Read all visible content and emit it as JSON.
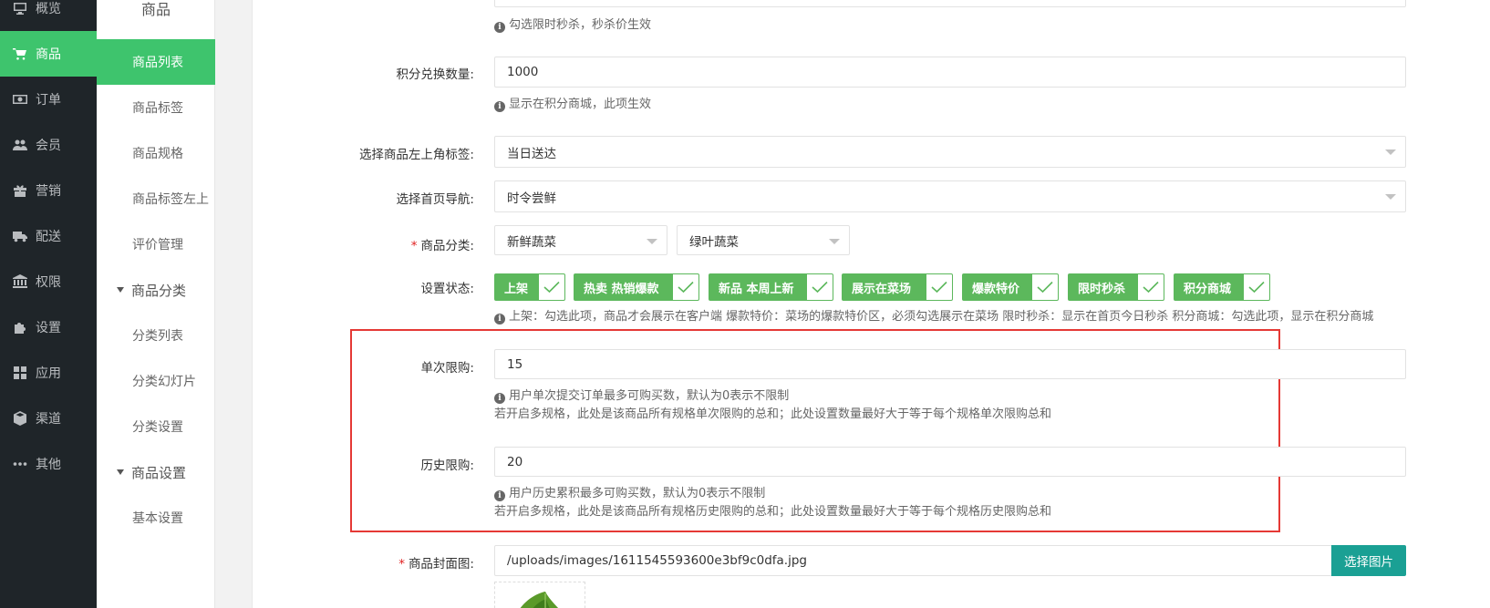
{
  "sidebar": {
    "items": [
      {
        "label": "概览",
        "icon": "monitor-icon"
      },
      {
        "label": "商品",
        "icon": "cart-icon"
      },
      {
        "label": "订单",
        "icon": "money-icon"
      },
      {
        "label": "会员",
        "icon": "users-icon"
      },
      {
        "label": "营销",
        "icon": "gift-icon"
      },
      {
        "label": "配送",
        "icon": "truck-icon"
      },
      {
        "label": "权限",
        "icon": "bank-icon"
      },
      {
        "label": "设置",
        "icon": "puzzle-icon"
      },
      {
        "label": "应用",
        "icon": "apps-icon"
      },
      {
        "label": "渠道",
        "icon": "cube-icon"
      },
      {
        "label": "其他",
        "icon": "dots-icon"
      }
    ]
  },
  "submenu": {
    "title": "商品",
    "items": {
      "list": "商品列表",
      "tags": "商品标签",
      "specs": "商品规格",
      "tag_topleft": "商品标签左上",
      "reviews": "评价管理",
      "group_category": "商品分类",
      "category_list": "分类列表",
      "category_slides": "分类幻灯片",
      "category_settings": "分类设置",
      "group_settings": "商品设置",
      "basic_settings": "基本设置"
    }
  },
  "form": {
    "flash_help": "勾选限时秒杀，秒杀价生效",
    "points": {
      "label": "积分兑换数量:",
      "value": "1000",
      "help": "显示在积分商城，此项生效"
    },
    "corner_tag": {
      "label": "选择商品左上角标签:",
      "value": "当日送达"
    },
    "home_nav": {
      "label": "选择首页导航:",
      "value": "时令尝鲜"
    },
    "category": {
      "required": "*",
      "label": "商品分类:",
      "first": "新鲜蔬菜",
      "second": "绿叶蔬菜"
    },
    "status": {
      "label": "设置状态:",
      "tags": [
        "上架",
        "热卖 热销爆款",
        "新品 本周上新",
        "展示在菜场",
        "爆款特价",
        "限时秒杀",
        "积分商城"
      ],
      "help": "上架：勾选此项，商品才会展示在客户端      爆款特价：菜场的爆款特价区，必须勾选展示在菜场      限时秒杀：显示在首页今日秒杀      积分商城：勾选此项，显示在积分商城"
    },
    "single_limit": {
      "label": "单次限购:",
      "value": "15",
      "help1": "用户单次提交订单最多可购买数，默认为0表示不限制",
      "help2": "若开启多规格，此处是该商品所有规格单次限购的总和；此处设置数量最好大于等于每个规格单次限购总和"
    },
    "history_limit": {
      "label": "历史限购:",
      "value": "20",
      "help1": "用户历史累积最多可购买数，默认为0表示不限制",
      "help2": "若开启多规格，此处是该商品所有规格历史限购的总和；此处设置数量最好大于等于每个规格历史限购总和"
    },
    "cover": {
      "required": "*",
      "label": "商品封面图:",
      "value": "/uploads/images/1611545593600e3bf9c0dfa.jpg",
      "button": "选择图片"
    }
  },
  "colors": {
    "accent": "#3ec46d",
    "tag": "#5cb85c",
    "highlight": "#e53935",
    "button": "#1aa094"
  }
}
